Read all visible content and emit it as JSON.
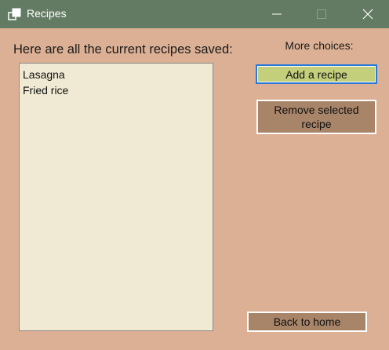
{
  "window": {
    "title": "Recipes",
    "icon": "window-restore-icon"
  },
  "main": {
    "heading": "Here are all the current recipes saved:",
    "recipes": [
      "Lasagna",
      "Fried rice"
    ]
  },
  "side": {
    "heading": "More choices:",
    "add_label": "Add a recipe",
    "remove_label": "Remove selected recipe",
    "back_label": "Back to home"
  },
  "colors": {
    "titlebar": "#637b63",
    "background": "#dcb094",
    "list": "#f0ead4",
    "add_button": "#c3cf7b",
    "other_buttons": "#a88468"
  }
}
